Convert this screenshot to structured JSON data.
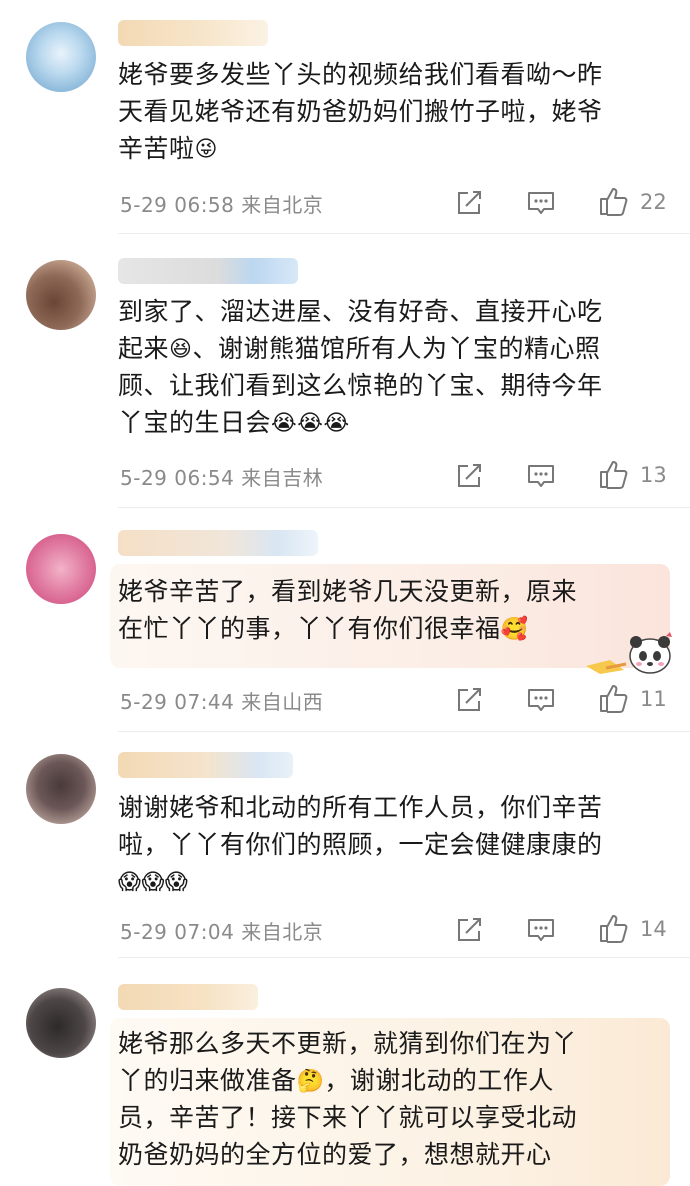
{
  "comments": [
    {
      "lines": [
        "姥爷要多发些丫头的视频给我们看看呦～昨",
        "天看见姥爷还有奶爸奶妈们搬竹子啦，姥爷",
        "辛苦啦"
      ],
      "date": "5-29 06:58",
      "location": "来自北京",
      "likes": "22",
      "emoji_icons": [
        "grinning-face-icon"
      ]
    },
    {
      "lines": [
        "到家了、溜达进屋、没有好奇、直接开心吃",
        "起来",
        "、谢谢熊猫馆所有人为丫宝的精心照",
        "顾、让我们看到这么惊艳的丫宝、期待今年",
        "丫宝的生日会"
      ],
      "date": "5-29 06:54",
      "location": "来自吉林",
      "likes": "13",
      "emoji_icons": [
        "laughing-face-icon",
        "moved-face-icon",
        "moved-face-icon",
        "moved-face-icon"
      ]
    },
    {
      "lines": [
        "姥爷辛苦了，看到姥爷几天没更新，原来",
        "在忙丫丫的事，丫丫有你们很幸福"
      ],
      "date": "5-29 07:44",
      "location": "来自山西",
      "likes": "11",
      "emoji_icons": [
        "love-face-icon",
        "panda-sticker-icon"
      ]
    },
    {
      "lines": [
        "谢谢姥爷和北动的所有工作人员，你们辛苦",
        "啦，丫丫有你们的照顾，一定会健健康康的"
      ],
      "date": "5-29 07:04",
      "location": "来自北京",
      "likes": "14",
      "emoji_icons": [
        "cheer-face-icon",
        "cheer-face-icon",
        "cheer-face-icon"
      ]
    },
    {
      "lines": [
        "姥爷那么多天不更新，就猜到你们在为丫",
        "丫的归来做准备",
        "，谢谢北动的工作人",
        "员，辛苦了！接下来丫丫就可以享受北动",
        "奶爸奶妈的全方位的爱了，想想就开心"
      ],
      "emoji_icons": [
        "thinking-face-icon"
      ]
    }
  ],
  "colors": {
    "text": "#1a1a1a",
    "meta": "#8a8a8a",
    "divider": "#ededed"
  }
}
